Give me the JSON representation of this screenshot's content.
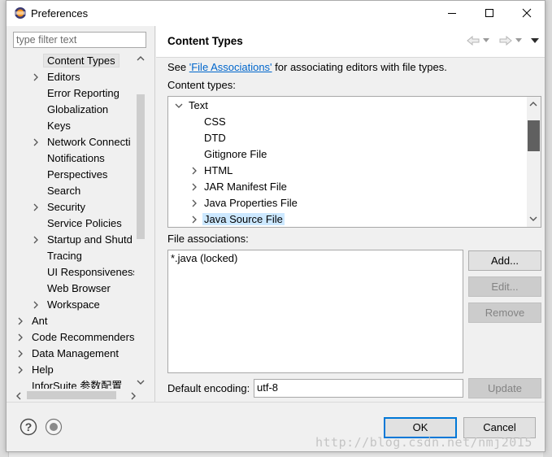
{
  "window": {
    "title": "Preferences"
  },
  "filter": {
    "placeholder": "type filter text"
  },
  "left_tree": [
    {
      "label": "Content Types",
      "indent": 2,
      "expander": false,
      "selected": true
    },
    {
      "label": "Editors",
      "indent": 2,
      "expander": true
    },
    {
      "label": "Error Reporting",
      "indent": 2,
      "expander": false
    },
    {
      "label": "Globalization",
      "indent": 2,
      "expander": false
    },
    {
      "label": "Keys",
      "indent": 2,
      "expander": false
    },
    {
      "label": "Network Connecti",
      "indent": 2,
      "expander": true
    },
    {
      "label": "Notifications",
      "indent": 2,
      "expander": false
    },
    {
      "label": "Perspectives",
      "indent": 2,
      "expander": false
    },
    {
      "label": "Search",
      "indent": 2,
      "expander": false
    },
    {
      "label": "Security",
      "indent": 2,
      "expander": true
    },
    {
      "label": "Service Policies",
      "indent": 2,
      "expander": false
    },
    {
      "label": "Startup and Shutd",
      "indent": 2,
      "expander": true
    },
    {
      "label": "Tracing",
      "indent": 2,
      "expander": false
    },
    {
      "label": "UI Responsiveness",
      "indent": 2,
      "expander": false
    },
    {
      "label": "Web Browser",
      "indent": 2,
      "expander": false
    },
    {
      "label": "Workspace",
      "indent": 2,
      "expander": true
    },
    {
      "label": "Ant",
      "indent": 1,
      "expander": true
    },
    {
      "label": "Code Recommenders",
      "indent": 1,
      "expander": true
    },
    {
      "label": "Data Management",
      "indent": 1,
      "expander": true
    },
    {
      "label": "Help",
      "indent": 1,
      "expander": true
    },
    {
      "label": "InforSuite 参数配置",
      "indent": 1,
      "expander": false
    }
  ],
  "page": {
    "title": "Content Types",
    "see_prefix": "See ",
    "see_link": "'File Associations'",
    "see_suffix": " for associating editors with file types.",
    "content_types_label": "Content types:",
    "file_assoc_label": "File associations:",
    "encoding_label": "Default encoding:",
    "encoding_value": "utf-8"
  },
  "content_types": [
    {
      "label": "Text",
      "level": 0,
      "expander": "open"
    },
    {
      "label": "CSS",
      "level": 1,
      "expander": "none"
    },
    {
      "label": "DTD",
      "level": 1,
      "expander": "none"
    },
    {
      "label": "Gitignore File",
      "level": 1,
      "expander": "none"
    },
    {
      "label": "HTML",
      "level": 1,
      "expander": "closed"
    },
    {
      "label": "JAR Manifest File",
      "level": 1,
      "expander": "closed"
    },
    {
      "label": "Java Properties File",
      "level": 1,
      "expander": "closed"
    },
    {
      "label": "Java Source File",
      "level": 1,
      "expander": "closed",
      "selected": true
    }
  ],
  "file_associations": [
    "*.java (locked)"
  ],
  "buttons": {
    "add": "Add...",
    "edit": "Edit...",
    "remove": "Remove",
    "update": "Update",
    "ok": "OK",
    "cancel": "Cancel"
  },
  "watermark": "http://blog.csdn.net/nmj2015",
  "colors": {
    "selection": "#cce8ff",
    "link": "#0066cc",
    "default_button_border": "#0078d7"
  }
}
